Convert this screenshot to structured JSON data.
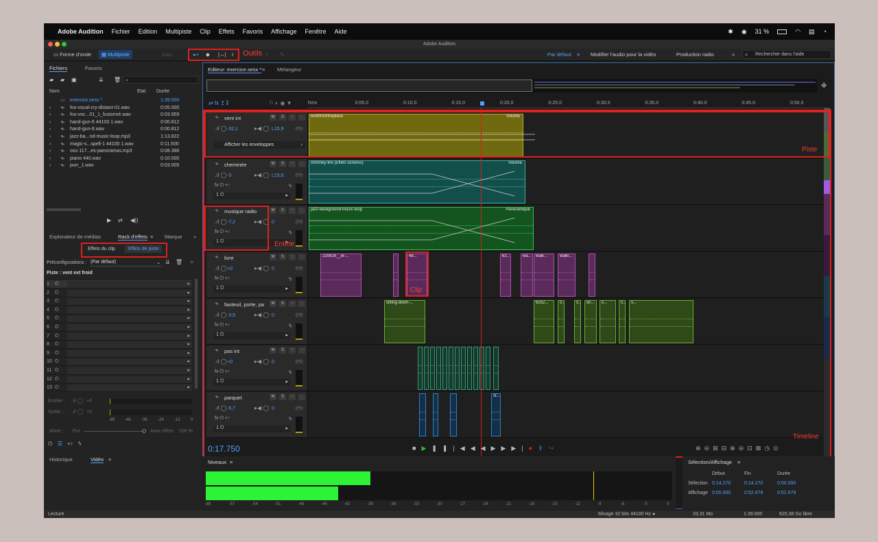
{
  "menubar": {
    "app": "Adobe Audition",
    "items": [
      "Fichier",
      "Edition",
      "Multipiste",
      "Clip",
      "Effets",
      "Favoris",
      "Affichage",
      "Fenêtre",
      "Aide"
    ],
    "battery": "31 %"
  },
  "window_title": "Adobe Audition",
  "toolbar": {
    "waveform": "Forme d'onde",
    "multitrack": "Multipiste",
    "tools_label": "Outils",
    "workspaces": [
      "Par défaut",
      "Modifier l'audio pour la vidéo",
      "Production radio"
    ],
    "search_placeholder": "Rechercher dans l'aide"
  },
  "files_panel": {
    "tabs": [
      "Fichiers",
      "Favoris"
    ],
    "col_name": "Nom",
    "col_state": "Etat",
    "col_duration": "Durée",
    "files": [
      {
        "name": "exercice.sesx *",
        "duration": "1:39.000"
      },
      {
        "name": "fox-vocal-cry-distant-01.wav",
        "duration": "0:05.000"
      },
      {
        "name": "fox-voc...01_1_fusionné.wav",
        "duration": "0:03.959"
      },
      {
        "name": "hand-gun-6 44100 1.wav",
        "duration": "0:00.812"
      },
      {
        "name": "hand-gun-6.wav",
        "duration": "0:00.812"
      },
      {
        "name": "jazz-ba...nd-music-loop.mp3",
        "duration": "1:13.822"
      },
      {
        "name": "magic-s...spell-1 44100 1.wav",
        "duration": "0:11.500"
      },
      {
        "name": "oss-117...es-panoramas.mp3",
        "duration": "0:08.388"
      },
      {
        "name": "piano 440.wav",
        "duration": "0:10.000"
      },
      {
        "name": "purr_1.wav",
        "duration": "0:03.005"
      }
    ]
  },
  "effects_panel": {
    "tabs": [
      "Explorateur de médias",
      "Rack d'effets",
      "Marque"
    ],
    "clip_fx": "Effets du clip",
    "track_fx": "Effets de piste",
    "presets_label": "Préconfigurations :",
    "preset_value": "(Par défaut)",
    "track_label": "Piste : vent ext froid",
    "slots": [
      "1",
      "2",
      "3",
      "4",
      "5",
      "6",
      "7",
      "8",
      "9",
      "10",
      "11",
      "12",
      "13"
    ],
    "input": "Entrée :",
    "output": "Sortie :",
    "io_value": "+0",
    "mixer": "Mixer :",
    "dry": "Pur",
    "wet": "Avec effets",
    "wet_pct": "100 %",
    "db_scale": [
      "dB",
      "-48",
      "-36",
      "-24",
      "-12",
      "0"
    ]
  },
  "bottom_left_tabs": [
    "Historique",
    "Vidéo"
  ],
  "editor": {
    "tabs": [
      "Editeur: exercice.sesx *",
      "Mélangeur"
    ],
    "timecode": "0:17.750",
    "ruler": [
      "hms",
      "0:05.0",
      "0:10.0",
      "0:15.0",
      "0:20.0",
      "0:25.0",
      "0:30.0",
      "0:35.0",
      "0:40.0",
      "0:45.0",
      "0:50.0"
    ],
    "show_envelopes": "Afficher les enveloppes",
    "tracks": [
      {
        "name": "vent int",
        "vol": "-32,1",
        "pan": "L15,9"
      },
      {
        "name": "cheminée",
        "vol": "-3",
        "pan": "L15,6"
      },
      {
        "name": "musique radio",
        "vol": "-7,2",
        "pan": "0"
      },
      {
        "name": "livre",
        "vol": "+0",
        "pan": "0"
      },
      {
        "name": "fauteuil, porte, pa",
        "vol": "-3,9",
        "pan": "0"
      },
      {
        "name": "pas int",
        "vol": "+0",
        "pan": "0"
      },
      {
        "name": "parquet",
        "vol": "-5,7",
        "pan": "0"
      }
    ],
    "clips": {
      "c1": "windfromfireplace",
      "c1env": "Volume",
      "c2": "chimney-fire (Effets sonores)",
      "c2env": "Volume",
      "c3": "jazz-background-music-loop",
      "c3env": "Panoramique",
      "livre": [
        "220828__el-...",
        "48...",
        "62...",
        "wa...",
        "walk...",
        "walki..."
      ],
      "fauteuil": [
        "sitting-down-...",
        "6252...",
        "s...",
        "s...",
        "sn...",
        "s...",
        "s...",
        "s..."
      ],
      "parquet": [
        "st..."
      ]
    },
    "annotations": {
      "piste": "Piste",
      "entete": "Entête",
      "clip": "Clip",
      "timeline": "Timeline"
    },
    "msr": [
      "M",
      "S",
      "R",
      "I"
    ]
  },
  "levels": {
    "title": "Niveaux",
    "scale": [
      "dB",
      "-57",
      "-54",
      "-51",
      "-48",
      "-45",
      "-42",
      "-39",
      "-36",
      "-33",
      "-30",
      "-27",
      "-24",
      "-21",
      "-18",
      "-15",
      "-12",
      "-9",
      "-6",
      "-3",
      "0"
    ]
  },
  "selection": {
    "title": "Sélection/Affichage",
    "start": "Début",
    "end": "Fin",
    "duration": "Durée",
    "sel_label": "Sélection",
    "sel": [
      "0:14.270",
      "0:14.270",
      "0:00.000"
    ],
    "view_label": "Affichage",
    "view": [
      "0:00.000",
      "0:52.679",
      "0:52.679"
    ]
  },
  "status": {
    "left": "Lecture",
    "mix": "Mixage 32 bits 44100 Hz ●",
    "size": "33,31 Mo",
    "dur": "1:39.000",
    "free": "620,38 Go libre"
  },
  "colors": {
    "accent": "#4ea3ff",
    "annotation": "#e0211d",
    "level": "#2df236"
  }
}
